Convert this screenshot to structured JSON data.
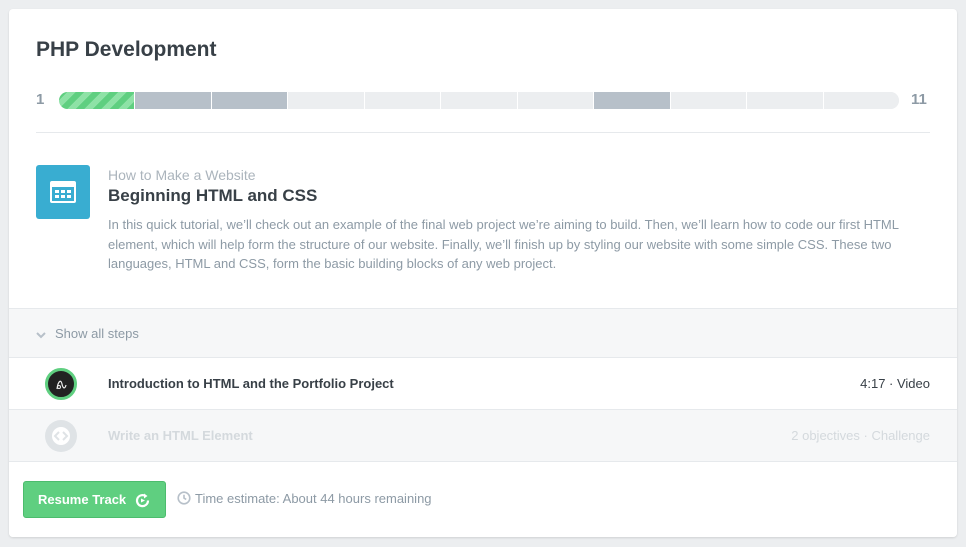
{
  "track": {
    "title": "PHP Development",
    "progress": {
      "start_label": "1",
      "end_label": "11",
      "segments": [
        "active",
        "done",
        "done",
        "todo",
        "todo",
        "todo",
        "todo",
        "done",
        "todo",
        "todo",
        "todo"
      ]
    }
  },
  "stage": {
    "icon": "grid-window-icon",
    "course": "How to Make a Website",
    "title": "Beginning HTML and CSS",
    "description": "In this quick tutorial, we’ll check out an example of the final web project we’re aiming to build. Then, we’ll learn how to code our first HTML element, which will help form the structure of our website. Finally, we’ll finish up by styling our website with some simple CSS. These two languages, HTML and CSS, form the basic building blocks of any web project."
  },
  "show_all": {
    "label": "Show all steps",
    "icon": "chevron-down-icon"
  },
  "steps": [
    {
      "title": "Introduction to HTML and the Portfolio Project",
      "meta": "4:17 · Video",
      "icon": "video-avatar-icon"
    },
    {
      "title": "Write an HTML Element",
      "meta": "2 objectives · Challenge",
      "icon": "code-challenge-icon"
    }
  ],
  "footer": {
    "resume_label": "Resume Track",
    "estimate": "Time estimate: About 44 hours remaining"
  },
  "colors": {
    "accent_green": "#5fcf80",
    "stage_blue": "#39add1",
    "progress_done": "#b7c0c9",
    "progress_todo": "#eceef0"
  }
}
